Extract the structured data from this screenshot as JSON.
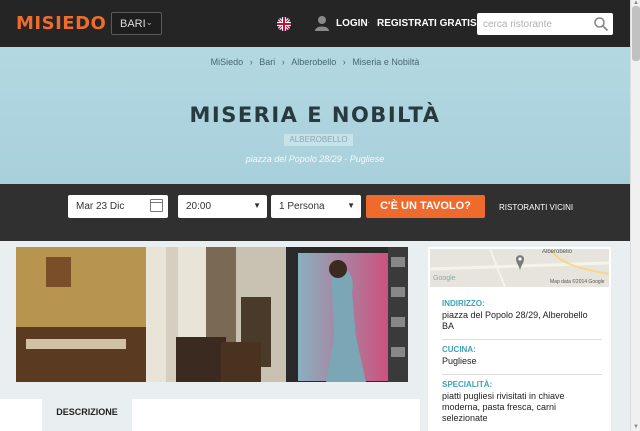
{
  "header": {
    "logo": "MISIEDO",
    "city": "BARI",
    "language_icon": "uk-flag-icon",
    "login": "LOGIN",
    "separator": "·",
    "register": "REGISTRATI GRATIS",
    "search_placeholder": "cerca ristorante"
  },
  "breadcrumb": [
    "MiSiedo",
    "Bari",
    "Alberobello",
    "Miseria e Nobiltà"
  ],
  "breadcrumb_sep": "›",
  "restaurant": {
    "name": "MISERIA E NOBILTÀ",
    "city_badge": "ALBEROBELLO",
    "subtitle": "piazza del Popolo 28/29 - Pugliese"
  },
  "booking": {
    "date": "Mar 23 Dic",
    "time": "20:00",
    "persons": "1 Persona",
    "cta": "C'È UN TAVOLO?",
    "nearby": "RISTORANTI VICINI"
  },
  "tabs": {
    "description": "DESCRIZIONE"
  },
  "map": {
    "place": "Alberobello",
    "attribution": "Map data ©2014 Google",
    "brand": "Google"
  },
  "info": {
    "address_label": "INDIRIZZO:",
    "address_line1": "piazza del Popolo 28/29, Alberobello",
    "address_line2": "BA",
    "cuisine_label": "CUCINA:",
    "cuisine": "Pugliese",
    "specialty_label": "SPECIALITÀ:",
    "specialty_line1": "piatti pugliesi rivisitati in chiave",
    "specialty_line2": "moderna, pasta fresca, carni",
    "specialty_line3": "selezionate"
  },
  "colors": {
    "accent": "#ef6a2d",
    "label": "#3fa2b8",
    "hero": "#afd4de",
    "dark": "#252525"
  }
}
